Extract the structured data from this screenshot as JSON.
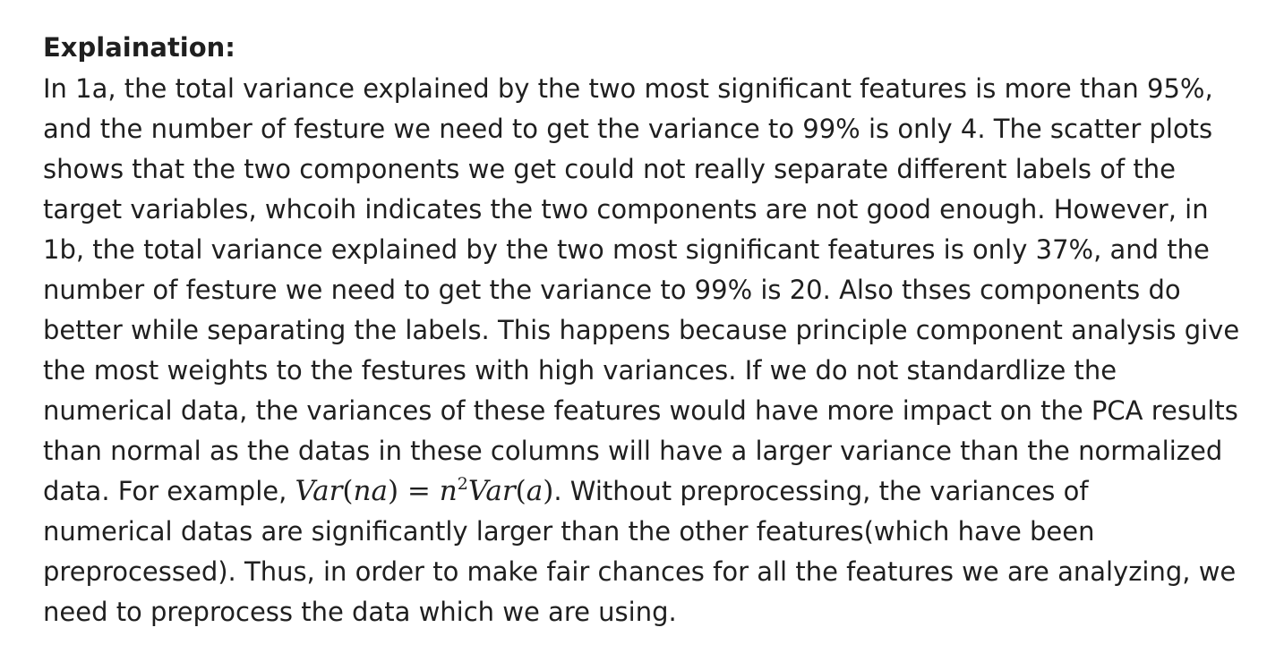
{
  "heading": "Explaination:",
  "lines": [
    "In 1a, the total variance explained by the two most significant features is more than 95%,",
    "and the number of festure we need to get the variance to 99% is only 4. The scatter plots",
    "shows that the two components we get could not really separate different labels of the",
    "target variables, whcoih indicates the two components are not good enough. However, in",
    "1b, the total variance explained by the two most significant features is only 37%, and the",
    "number of festure we need to get the variance to 99% is 20. Also thses components do",
    "better while separating the labels. This happens because principle component analysis give",
    "the most weights to the festures with high variances. If we do not standardlize the",
    "numerical data, the variances of these features would have more impact on the PCA results",
    "than normal as the datas in these columns will have a larger variance than the normalized"
  ],
  "example_line": {
    "before": "data. For example, ",
    "formula": {
      "lhs_func": "Var",
      "lhs_arg": "na",
      "equals": " = ",
      "coef": "n",
      "exponent": "2",
      "rhs_func": "Var",
      "rhs_arg": "a"
    },
    "after": ". Without preprocessing, the variances of"
  },
  "lines_after": [
    "numerical datas are significantly larger than the other features(which have been",
    "preprocessed). Thus, in order to make fair chances for all the features we are analyzing, we",
    "need to preprocess the data which we are using."
  ]
}
